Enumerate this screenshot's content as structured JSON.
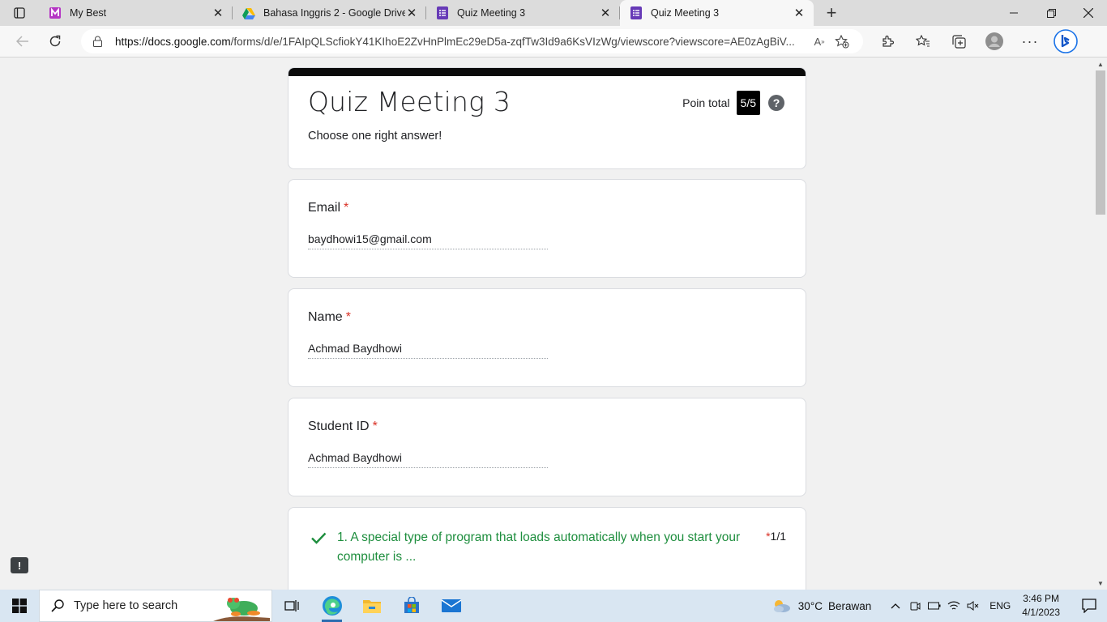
{
  "browser": {
    "tabs": [
      {
        "title": "My Best",
        "active": false,
        "icon": "my-best-logo"
      },
      {
        "title": "Bahasa Inggris 2 - Google Drive",
        "active": false,
        "icon": "google-drive-icon"
      },
      {
        "title": "Quiz Meeting 3",
        "active": false,
        "icon": "google-forms-icon"
      },
      {
        "title": "Quiz Meeting 3",
        "active": true,
        "icon": "google-forms-icon"
      }
    ],
    "url_domain": "https://docs.google.com",
    "url_path": "/forms/d/e/1FAIpQLScfiokY41KIhoE2ZvHnPlmEc29eD5a-zqfTw3Id9a6KsVIzWg/viewscore?viewscore=AE0zAgBiV..."
  },
  "form": {
    "title": "Quiz Meeting 3",
    "description": "Choose one right answer!",
    "score_label": "Poin total",
    "score": "5/5",
    "help": "?",
    "accent": "#0b0b0b"
  },
  "questions": [
    {
      "label": "Email",
      "required": "*",
      "answer": "baydhowi15@gmail.com"
    },
    {
      "label": "Name",
      "required": "*",
      "answer": "Achmad Baydhowi"
    },
    {
      "label": "Student ID",
      "required": "*",
      "answer": "Achmad Baydhowi"
    }
  ],
  "quiz": {
    "question": "1. A special type of program that loads automatically when you start your computer is ...",
    "required": "*",
    "score": "1/1",
    "correct_color": "#1e8e3e"
  },
  "taskbar": {
    "search_placeholder": "Type here to search",
    "weather_temp": "30°C",
    "weather_text": "Berawan",
    "language": "ENG",
    "time": "3:46 PM",
    "date": "4/1/2023"
  }
}
